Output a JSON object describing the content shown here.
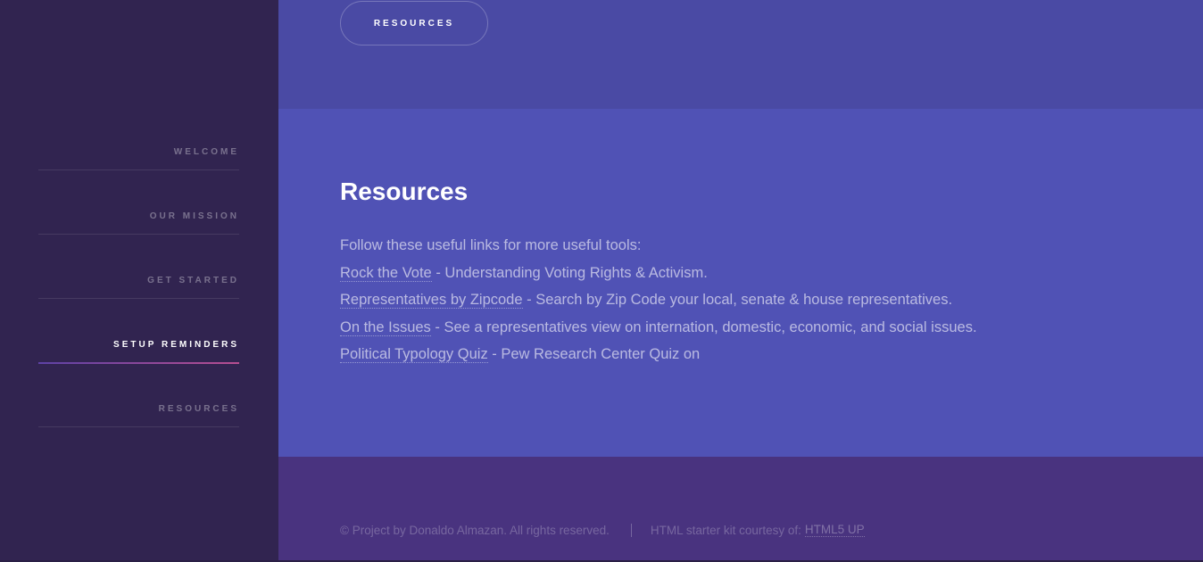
{
  "sidebar": {
    "items": [
      {
        "label": "Welcome"
      },
      {
        "label": "Our Mission"
      },
      {
        "label": "Get Started"
      },
      {
        "label": "Setup Reminders"
      },
      {
        "label": "Resources"
      }
    ],
    "active_label": "Setup Reminders"
  },
  "top_section": {
    "button_label": "Resources"
  },
  "resources": {
    "title": "Resources",
    "intro": "Follow these useful links for more useful tools:",
    "links": [
      {
        "text": "Rock the Vote",
        "desc": " - Understanding Voting Rights & Activism."
      },
      {
        "text": "Representatives by Zipcode",
        "desc": " - Search by Zip Code your local, senate & house representatives."
      },
      {
        "text": "On the Issues",
        "desc": " - See a representatives view on internation, domestic, economic, and social issues."
      },
      {
        "text": "Political Typology Quiz",
        "desc": " - Pew Research Center Quiz on"
      }
    ]
  },
  "footer": {
    "copyright": "© Project by Donaldo Almazan. All rights reserved.",
    "credit_prefix": "HTML starter kit courtesy of:",
    "credit_link": "HTML5 UP"
  },
  "colors": {
    "sidebar_bg": "#312450",
    "top_section_bg": "#4a4aa4",
    "resources_bg": "#5052b5",
    "footer_bg": "#49337f",
    "active_gradient_start": "#5e42a6",
    "active_gradient_end": "#b74e91"
  }
}
